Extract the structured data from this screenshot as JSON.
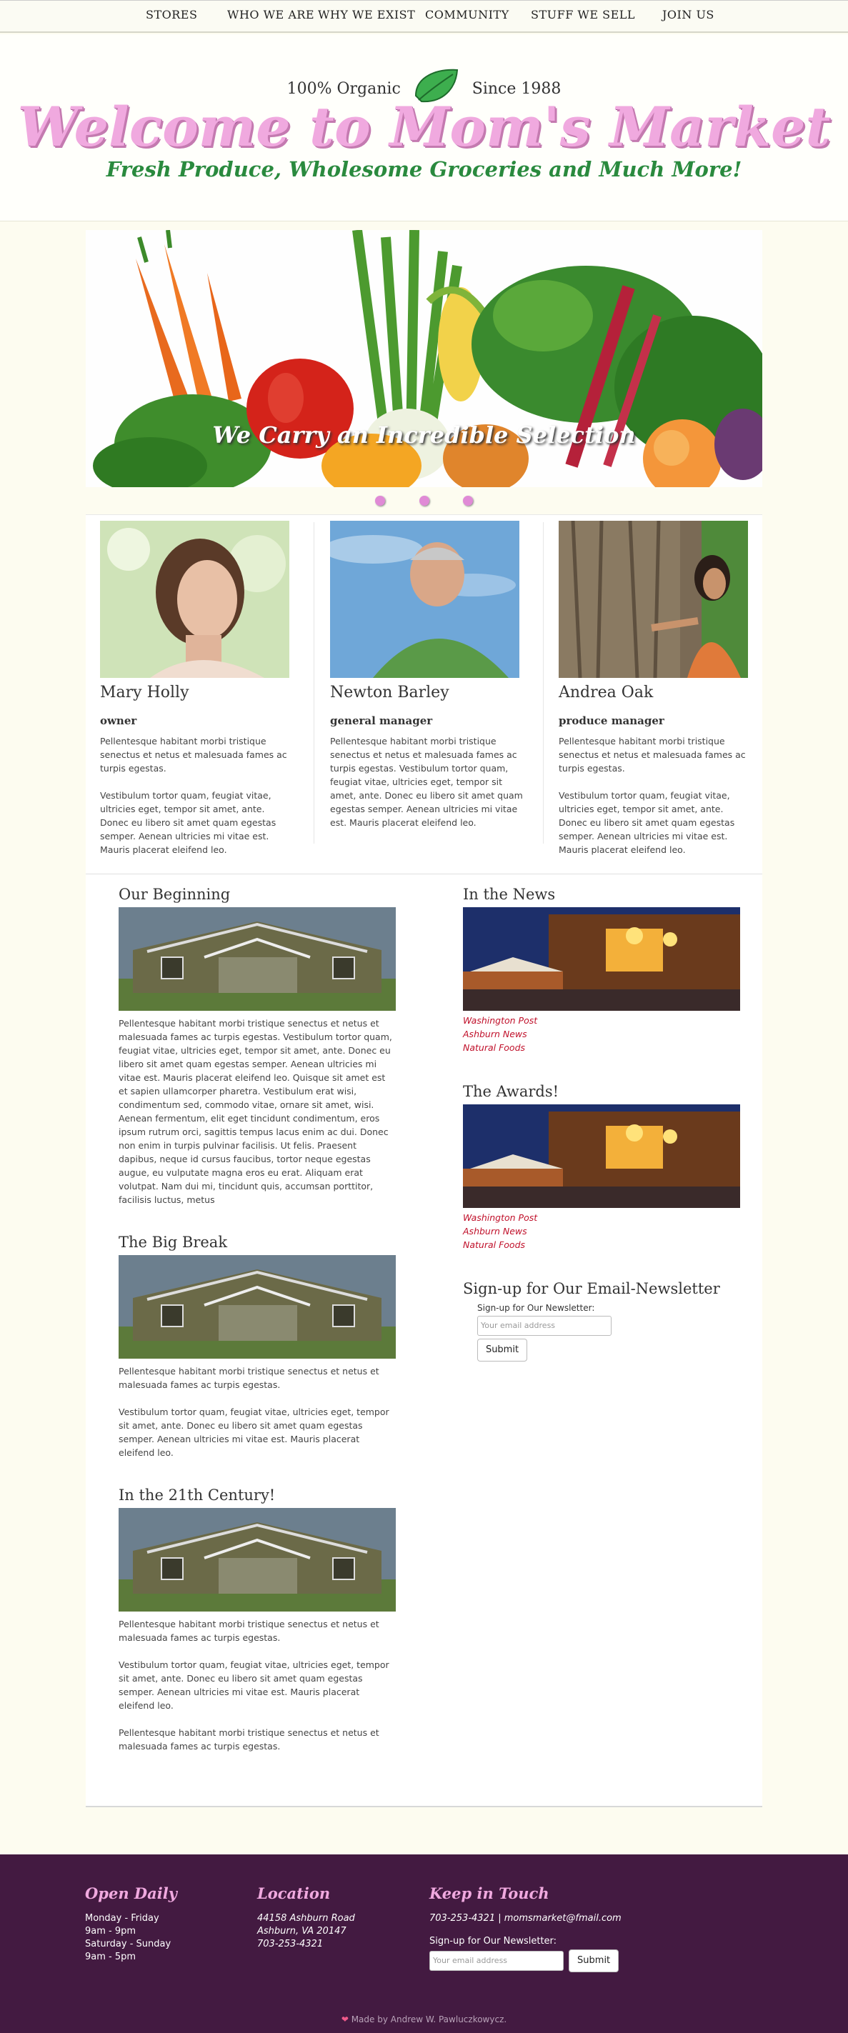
{
  "nav": [
    "STORES",
    "WHO WE ARE",
    "WHY WE EXIST",
    "COMMUNITY",
    "STUFF WE SELL",
    "JOIN US"
  ],
  "header": {
    "left_text": "100% Organic",
    "right_text": "Since 1988",
    "title": "Welcome to Mom's Market",
    "tagline": "Fresh Produce, Wholesome Groceries and Much More!"
  },
  "banner": {
    "caption": "We Carry an Incredible Selection",
    "slides": 3
  },
  "staff": [
    {
      "name": "Mary Holly",
      "role": "owner",
      "p1": "Pellentesque habitant morbi tristique senectus et netus et malesuada fames ac turpis egestas.",
      "p2": "Vestibulum tortor quam, feugiat vitae, ultricies eget, tempor sit amet, ante. Donec eu libero sit amet quam egestas semper. Aenean ultricies mi vitae est. Mauris placerat eleifend leo."
    },
    {
      "name": "Newton Barley",
      "role": "general manager",
      "p1": "Pellentesque habitant morbi tristique senectus et netus et malesuada fames ac turpis egestas. Vestibulum tortor quam, feugiat vitae, ultricies eget, tempor sit amet, ante. Donec eu libero sit amet quam egestas semper. Aenean ultricies mi vitae est. Mauris placerat eleifend leo.",
      "p2": ""
    },
    {
      "name": "Andrea Oak",
      "role": "produce manager",
      "p1": "Pellentesque habitant morbi tristique senectus et netus et malesuada fames ac turpis egestas.",
      "p2": "Vestibulum tortor quam, feugiat vitae, ultricies eget, tempor sit amet, ante. Donec eu libero sit amet quam egestas semper. Aenean ultricies mi vitae est. Mauris placerat eleifend leo."
    }
  ],
  "history": [
    {
      "title": "Our Beginning",
      "paras": [
        "Pellentesque habitant morbi tristique senectus et netus et malesuada fames ac turpis egestas. Vestibulum tortor quam, feugiat vitae, ultricies eget, tempor sit amet, ante. Donec eu libero sit amet quam egestas semper. Aenean ultricies mi vitae est. Mauris placerat eleifend leo. Quisque sit amet est et sapien ullamcorper pharetra. Vestibulum erat wisi, condimentum sed, commodo vitae, ornare sit amet, wisi. Aenean fermentum, elit eget tincidunt condimentum, eros ipsum rutrum orci, sagittis tempus lacus enim ac dui. Donec non enim in turpis pulvinar facilisis. Ut felis. Praesent dapibus, neque id cursus faucibus, tortor neque egestas augue, eu vulputate magna eros eu erat. Aliquam erat volutpat. Nam dui mi, tincidunt quis, accumsan porttitor, facilisis luctus, metus"
      ]
    },
    {
      "title": "The Big Break",
      "paras": [
        "Pellentesque habitant morbi tristique senectus et netus et malesuada fames ac turpis egestas.",
        "Vestibulum tortor quam, feugiat vitae, ultricies eget, tempor sit amet, ante. Donec eu libero sit amet quam egestas semper. Aenean ultricies mi vitae est. Mauris placerat eleifend leo."
      ]
    },
    {
      "title": "In the 21th Century!",
      "paras": [
        "Pellentesque habitant morbi tristique senectus et netus et malesuada fames ac turpis egestas.",
        "Vestibulum tortor quam, feugiat vitae, ultricies eget, tempor sit amet, ante. Donec eu libero sit amet quam egestas semper. Aenean ultricies mi vitae est. Mauris placerat eleifend leo.",
        "Pellentesque habitant morbi tristique senectus et netus et malesuada fames ac turpis egestas."
      ]
    }
  ],
  "news": {
    "title": "In the News",
    "links": [
      "Washington Post",
      "Ashburn News",
      "Natural Foods"
    ]
  },
  "awards": {
    "title": "The Awards!",
    "links": [
      "Washington Post",
      "Ashburn News",
      "Natural Foods"
    ]
  },
  "signup": {
    "title": "Sign-up for Our Email-Newsletter",
    "label": "Sign-up for Our Newsletter:",
    "placeholder": "Your email address",
    "button": "Submit"
  },
  "footer": {
    "hours_title": "Open Daily",
    "hours": [
      "Monday - Friday",
      "9am - 9pm",
      "Saturday - Sunday",
      "9am - 5pm"
    ],
    "location_title": "Location",
    "location": [
      "44158 Ashburn Road",
      "Ashburn, VA 20147",
      "703-253-4321"
    ],
    "contact_title": "Keep in Touch",
    "contact_line": "703-253-4321 | momsmarket@fmail.com",
    "signup_label": "Sign-up for Our Newsletter:",
    "placeholder": "Your email address",
    "button": "Submit",
    "credit": "Made by Andrew W. Pawluczkowycz."
  },
  "colors": {
    "pink": "#f0a9df",
    "green": "#2a8a3e",
    "footer": "#431a41",
    "link_red": "#c0102a"
  }
}
